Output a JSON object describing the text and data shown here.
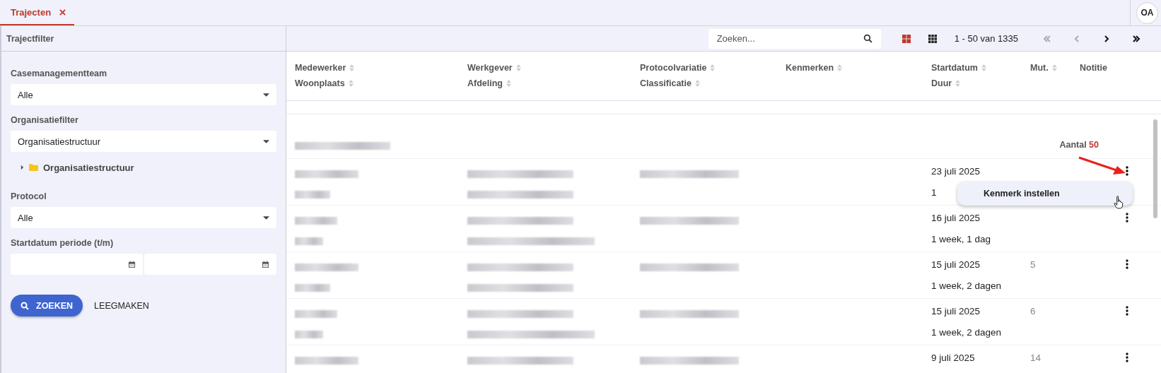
{
  "tabs": [
    {
      "label": "Trajecten",
      "selected": true
    }
  ],
  "user": {
    "initials": "OA"
  },
  "filter": {
    "title": "Trajectfilter",
    "fields": [
      {
        "kind": "select",
        "label": "Casemanagementteam",
        "value": "Alle"
      },
      {
        "kind": "select",
        "label": "Organisatiefilter",
        "value": "Organisatiestructuur"
      },
      {
        "kind": "tree",
        "label": "Organisatiestructuur",
        "expanded": false
      },
      {
        "kind": "select",
        "label": "Protocol",
        "value": "Alle"
      },
      {
        "kind": "daterange",
        "label": "Startdatum periode (t/m)"
      }
    ],
    "search_button": "ZOEKEN",
    "clear_button": "LEEGMAKEN"
  },
  "toolbar": {
    "search_placeholder": "Zoeken...",
    "pagination": "1 - 50 van 1335",
    "first_disabled": true,
    "prev_disabled": true
  },
  "table": {
    "columns": [
      {
        "top": "Medewerker",
        "bottom": "Woonplaats",
        "sortable": true
      },
      {
        "top": "Werkgever",
        "bottom": "Afdeling",
        "sortable": true
      },
      {
        "top": "Protocolvariatie",
        "bottom": "Classificatie",
        "sortable": true
      },
      {
        "top": "Kenmerken",
        "sortable": true
      },
      {
        "top": "Startdatum",
        "bottom": "Duur",
        "sortable": true
      },
      {
        "top": "Mut.",
        "sortable": true
      },
      {
        "top": "Notitie",
        "sortable": false
      }
    ],
    "group": {
      "label": "Aantal",
      "count": "50"
    },
    "rows": [
      {
        "start": "23 juli 2025",
        "duration": "1",
        "mut": "",
        "menu_open": true
      },
      {
        "start": "16 juli 2025",
        "duration": "1 week, 1 dag",
        "mut": "",
        "menu_open": false
      },
      {
        "start": "15 juli 2025",
        "duration": "1 week, 2 dagen",
        "mut": "5",
        "menu_open": false
      },
      {
        "start": "15 juli 2025",
        "duration": "1 week, 2 dagen",
        "mut": "6",
        "menu_open": false
      },
      {
        "start": "9 juli 2025",
        "duration": "",
        "mut": "14",
        "menu_open": false
      }
    ]
  },
  "context_menu": {
    "items": [
      "Kenmerk instellen"
    ]
  }
}
